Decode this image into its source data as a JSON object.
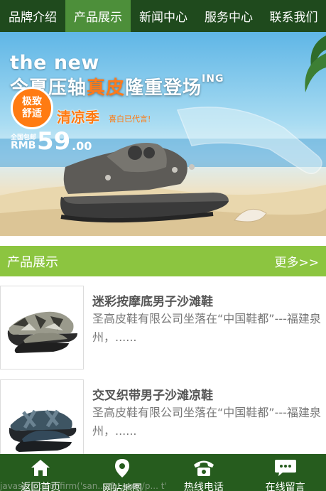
{
  "nav": {
    "items": [
      {
        "label": "品牌介绍"
      },
      {
        "label": "产品展示"
      },
      {
        "label": "新闻中心"
      },
      {
        "label": "服务中心"
      },
      {
        "label": "联系我们"
      }
    ],
    "active_index": 1
  },
  "banner": {
    "the_new": "the new",
    "headline_a": "今夏压轴",
    "headline_hl": "真皮",
    "headline_b": "隆重登场",
    "headline_sup": "ING",
    "badge_line1": "极致",
    "badge_line2": "舒适",
    "cool": "清凉季",
    "cool_sub": "喜白已代言!",
    "price_note": "全国包邮",
    "price_currency": "RMB",
    "price_value": "59",
    "price_decimal": ".00"
  },
  "section": {
    "title": "产品展示",
    "more": "更多>>"
  },
  "products": [
    {
      "title": "迷彩按摩底男子沙滩鞋",
      "desc": "圣高皮鞋有限公司坐落在“中国鞋都”---福建泉州，......"
    },
    {
      "title": "交叉织带男子沙滩凉鞋",
      "desc": "圣高皮鞋有限公司坐落在“中国鞋都”---福建泉州，......"
    }
  ],
  "bottombar": {
    "tabs": [
      {
        "label": "返回首页",
        "icon": "home-icon"
      },
      {
        "label": "网站地图",
        "icon": "map-pin-icon"
      },
      {
        "label": "热线电话",
        "icon": "phone-icon"
      },
      {
        "label": "在线留言",
        "icon": "message-icon"
      }
    ]
  },
  "status_text": "javascript:confirm('san...z1...com/p... t'",
  "colors": {
    "nav_bg": "#1f4a1d",
    "nav_active": "#4d8f3a",
    "section_bg": "#8cc540",
    "bottom_bg": "#265c1e",
    "accent_orange": "#ff7b12"
  }
}
